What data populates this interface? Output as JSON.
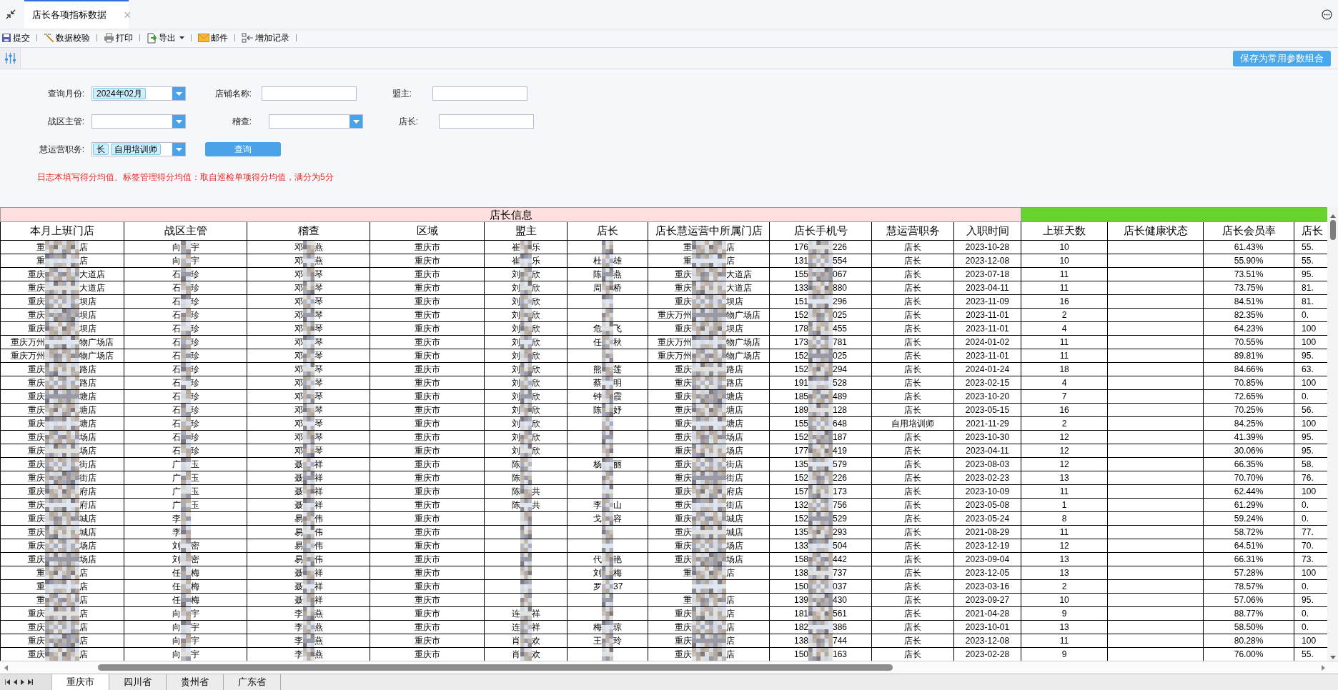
{
  "doc_tabs": [
    {
      "label": "店长各项指标数据",
      "selected": true,
      "close": "×"
    }
  ],
  "toolbar": [
    {
      "kind": "save",
      "label": "提交"
    },
    {
      "kind": "check",
      "label": "数据校验"
    },
    {
      "kind": "print",
      "label": "打印"
    },
    {
      "kind": "export",
      "label": "导出",
      "dropdown": true
    },
    {
      "kind": "mail",
      "label": "邮件"
    },
    {
      "kind": "add",
      "label": "增加记录"
    }
  ],
  "save_params_button": "保存为常用参数组合",
  "form": {
    "rows": [
      [
        {
          "label": "查询月份:",
          "kind": "combo",
          "tags": [
            "2024年02月"
          ]
        },
        {
          "label": "店铺名称:",
          "kind": "text"
        },
        {
          "label": "盟主:",
          "kind": "text"
        }
      ],
      [
        {
          "label": "战区主管:",
          "kind": "combo"
        },
        {
          "label": "稽查:",
          "kind": "combo"
        },
        {
          "label": "店长:",
          "kind": "text"
        }
      ],
      [
        {
          "label": "慧运营职务:",
          "kind": "combo",
          "tags": [
            "长",
            "自用培训师"
          ]
        },
        {
          "label": "查询",
          "kind": "button"
        }
      ]
    ],
    "note": "日志本填写得分均值、标签管理得分均值：取自巡检单项得分均值，满分为5分"
  },
  "table": {
    "groups": [
      {
        "label": "店长信息",
        "color": "#ffdfdf"
      },
      {
        "color": "#66d32e"
      }
    ],
    "columns": [
      {
        "header": "本月上班门店",
        "kind": "masked"
      },
      {
        "header": "战区主管",
        "kind": "masked"
      },
      {
        "header": "稽查",
        "kind": "masked"
      },
      {
        "header": "区域",
        "kind": "plain"
      },
      {
        "header": "盟主",
        "kind": "masked"
      },
      {
        "header": "店长",
        "kind": "masked"
      },
      {
        "header": "店长慧运营中所属门店",
        "kind": "masked"
      },
      {
        "header": "店长手机号",
        "kind": "masked"
      },
      {
        "header": "慧运营职务",
        "kind": "plain"
      },
      {
        "header": "入职时间",
        "kind": "plain"
      },
      {
        "header": "上班天数",
        "kind": "plain"
      },
      {
        "header": "店长健康状态",
        "kind": "plain"
      },
      {
        "header": "店长会员率",
        "kind": "plain"
      },
      {
        "header": "店长",
        "kind": "plain"
      }
    ],
    "rows": [
      [
        [
          "重",
          "店"
        ],
        [
          "向",
          "宇"
        ],
        [
          "邓",
          "燕"
        ],
        "重庆市",
        [
          "崔",
          "乐"
        ],
        null,
        [
          "重",
          "店"
        ],
        [
          "176",
          "226"
        ],
        "店长",
        "2023-10-28",
        "10",
        null,
        "61.43%",
        "55."
      ],
      [
        [
          "重",
          "店"
        ],
        [
          "向",
          "宇"
        ],
        [
          "邓",
          "燕"
        ],
        "重庆市",
        [
          "崔",
          "乐"
        ],
        [
          "杜",
          "雄"
        ],
        [
          "重",
          "店"
        ],
        [
          "131",
          "554"
        ],
        "店长",
        "2023-12-08",
        "10",
        null,
        "55.90%",
        "55."
      ],
      [
        [
          "重庆",
          "大道店"
        ],
        [
          "石",
          "珍"
        ],
        [
          "邓",
          "琴"
        ],
        "重庆市",
        [
          "刘",
          "欣"
        ],
        [
          "陈",
          "燕"
        ],
        [
          "重庆",
          "大道店"
        ],
        [
          "155",
          "067"
        ],
        "店长",
        "2023-07-18",
        "11",
        null,
        "73.51%",
        "95."
      ],
      [
        [
          "重庆",
          "大道店"
        ],
        [
          "石",
          "珍"
        ],
        [
          "邓",
          "琴"
        ],
        "重庆市",
        [
          "刘",
          "欣"
        ],
        [
          "周",
          "桥"
        ],
        [
          "重庆",
          "大道店"
        ],
        [
          "133",
          "880"
        ],
        "店长",
        "2023-04-11",
        "11",
        null,
        "73.75%",
        "81."
      ],
      [
        [
          "重庆",
          "坝店"
        ],
        [
          "石",
          "珍"
        ],
        [
          "邓",
          "琴"
        ],
        "重庆市",
        [
          "刘",
          "欣"
        ],
        null,
        [
          "重庆",
          "坝店"
        ],
        [
          "151",
          "296"
        ],
        "店长",
        "2023-11-09",
        "16",
        null,
        "84.51%",
        "81."
      ],
      [
        [
          "重庆",
          "坝店"
        ],
        [
          "石",
          "珍"
        ],
        [
          "邓",
          "琴"
        ],
        "重庆市",
        [
          "刘",
          "欣"
        ],
        null,
        [
          "重庆万州",
          "物广场店"
        ],
        [
          "152",
          "025"
        ],
        "店长",
        "2023-11-01",
        "2",
        null,
        "82.35%",
        "0."
      ],
      [
        [
          "重庆",
          "坝店"
        ],
        [
          "石",
          "珍"
        ],
        [
          "邓",
          "琴"
        ],
        "重庆市",
        [
          "刘",
          "欣"
        ],
        [
          "危",
          "飞"
        ],
        [
          "重庆",
          "坝店"
        ],
        [
          "178",
          "455"
        ],
        "店长",
        "2023-11-01",
        "4",
        null,
        "64.23%",
        "100"
      ],
      [
        [
          "重庆万州",
          "物广场店"
        ],
        [
          "石",
          "珍"
        ],
        [
          "邓",
          "琴"
        ],
        "重庆市",
        [
          "刘",
          "欣"
        ],
        [
          "任",
          "秋"
        ],
        [
          "重庆万州",
          "物广场店"
        ],
        [
          "173",
          "781"
        ],
        "店长",
        "2024-01-02",
        "11",
        null,
        "70.55%",
        "100"
      ],
      [
        [
          "重庆万州",
          "物广场店"
        ],
        [
          "石",
          "珍"
        ],
        [
          "邓",
          "琴"
        ],
        "重庆市",
        [
          "刘",
          "欣"
        ],
        null,
        [
          "重庆万州",
          "物广场店"
        ],
        [
          "152",
          "025"
        ],
        "店长",
        "2023-11-01",
        "11",
        null,
        "89.81%",
        "95."
      ],
      [
        [
          "重庆",
          "路店"
        ],
        [
          "石",
          "珍"
        ],
        [
          "邓",
          "琴"
        ],
        "重庆市",
        [
          "刘",
          "欣"
        ],
        [
          "熊",
          "莲"
        ],
        [
          "重庆",
          "路店"
        ],
        [
          "152",
          "294"
        ],
        "店长",
        "2024-01-24",
        "18",
        null,
        "84.66%",
        "63."
      ],
      [
        [
          "重庆",
          "路店"
        ],
        [
          "石",
          "珍"
        ],
        [
          "邓",
          "琴"
        ],
        "重庆市",
        [
          "刘",
          "欣"
        ],
        [
          "蔡",
          "明"
        ],
        [
          "重庆",
          "路店"
        ],
        [
          "191",
          "528"
        ],
        "店长",
        "2023-02-15",
        "4",
        null,
        "70.85%",
        "100"
      ],
      [
        [
          "重庆",
          "塘店"
        ],
        [
          "石",
          "珍"
        ],
        [
          "邓",
          "琴"
        ],
        "重庆市",
        [
          "刘",
          "欣"
        ],
        [
          "钟",
          "霞"
        ],
        [
          "重庆",
          "塘店"
        ],
        [
          "185",
          "489"
        ],
        "店长",
        "2023-10-20",
        "7",
        null,
        "72.65%",
        "0."
      ],
      [
        [
          "重庆",
          "塘店"
        ],
        [
          "石",
          "珍"
        ],
        [
          "邓",
          "琴"
        ],
        "重庆市",
        [
          "刘",
          "欣"
        ],
        [
          "陈",
          "妤"
        ],
        [
          "重庆",
          "塘店"
        ],
        [
          "189",
          "128"
        ],
        "店长",
        "2023-05-15",
        "16",
        null,
        "70.25%",
        "56."
      ],
      [
        [
          "重庆",
          "塘店"
        ],
        [
          "石",
          "珍"
        ],
        [
          "邓",
          "琴"
        ],
        "重庆市",
        [
          "刘",
          "欣"
        ],
        null,
        [
          "重庆",
          "塘店"
        ],
        [
          "155",
          "648"
        ],
        "自用培训师",
        "2021-11-29",
        "2",
        null,
        "84.25%",
        "100"
      ],
      [
        [
          "重庆",
          "场店"
        ],
        [
          "石",
          "珍"
        ],
        [
          "邓",
          "琴"
        ],
        "重庆市",
        [
          "刘",
          "欣"
        ],
        null,
        [
          "重庆",
          "场店"
        ],
        [
          "152",
          "187"
        ],
        "店长",
        "2023-10-30",
        "12",
        null,
        "41.39%",
        "95."
      ],
      [
        [
          "重庆",
          "场店"
        ],
        [
          "石",
          "珍"
        ],
        [
          "邓",
          "琴"
        ],
        "重庆市",
        [
          "刘",
          "欣"
        ],
        null,
        [
          "重庆",
          "场店"
        ],
        [
          "177",
          "419"
        ],
        "店长",
        "2023-04-11",
        "12",
        null,
        "30.06%",
        "95."
      ],
      [
        [
          "重庆",
          "街店"
        ],
        [
          "广",
          "玉"
        ],
        [
          "聂",
          "祥"
        ],
        "重庆市",
        [
          "陈",
          ""
        ],
        [
          "杨",
          "丽"
        ],
        [
          "重庆",
          "街店"
        ],
        [
          "135",
          "579"
        ],
        "店长",
        "2023-08-03",
        "12",
        null,
        "66.35%",
        "58."
      ],
      [
        [
          "重庆",
          "街店"
        ],
        [
          "广",
          "玉"
        ],
        [
          "聂",
          "祥"
        ],
        "重庆市",
        [
          "陈",
          ""
        ],
        null,
        [
          "重庆",
          "街店"
        ],
        [
          "152",
          "226"
        ],
        "店长",
        "2023-02-23",
        "13",
        null,
        "70.70%",
        "76."
      ],
      [
        [
          "重庆",
          "府店"
        ],
        [
          "广",
          "玉"
        ],
        [
          "聂",
          "祥"
        ],
        "重庆市",
        [
          "陈",
          "共"
        ],
        null,
        [
          "重庆",
          "府店"
        ],
        [
          "157",
          "173"
        ],
        "店长",
        "2023-10-09",
        "11",
        null,
        "62.44%",
        "100"
      ],
      [
        [
          "重庆",
          "府店"
        ],
        [
          "广",
          "玉"
        ],
        [
          "聂",
          "祥"
        ],
        "重庆市",
        [
          "陈",
          "共"
        ],
        [
          "李",
          "山"
        ],
        [
          "重庆",
          "街店"
        ],
        [
          "132",
          "756"
        ],
        "店长",
        "2023-05-08",
        "1",
        null,
        "61.29%",
        "0."
      ],
      [
        [
          "重庆",
          "城店"
        ],
        [
          "李",
          ""
        ],
        [
          "易",
          "伟"
        ],
        "重庆市",
        null,
        [
          "戈",
          "容"
        ],
        [
          "重庆",
          "城店"
        ],
        [
          "152",
          "529"
        ],
        "店长",
        "2023-05-24",
        "8",
        null,
        "59.24%",
        "0."
      ],
      [
        [
          "重庆",
          "城店"
        ],
        [
          "李",
          ""
        ],
        [
          "易",
          "伟"
        ],
        "重庆市",
        null,
        null,
        [
          "重庆",
          "城店"
        ],
        [
          "135",
          "293"
        ],
        "店长",
        "2021-08-29",
        "11",
        null,
        "58.72%",
        "77."
      ],
      [
        [
          "重庆",
          "场店"
        ],
        [
          "刘",
          "密"
        ],
        [
          "易",
          "伟"
        ],
        "重庆市",
        null,
        null,
        [
          "重庆",
          "场店"
        ],
        [
          "133",
          "504"
        ],
        "店长",
        "2023-12-19",
        "12",
        null,
        "64.51%",
        "70."
      ],
      [
        [
          "重庆",
          "场店"
        ],
        [
          "刘",
          "密"
        ],
        [
          "易",
          "伟"
        ],
        "重庆市",
        null,
        [
          "代",
          "艳"
        ],
        [
          "重庆",
          "场店"
        ],
        [
          "158",
          "442"
        ],
        "店长",
        "2023-09-04",
        "13",
        null,
        "66.31%",
        "73."
      ],
      [
        [
          "重",
          "店"
        ],
        [
          "任",
          "梅"
        ],
        [
          "聂",
          "祥"
        ],
        "重庆市",
        null,
        [
          "刘",
          "梅"
        ],
        [
          "重",
          "店"
        ],
        [
          "138",
          "737"
        ],
        "店长",
        "2023-12-05",
        "13",
        null,
        "57.28%",
        "100"
      ],
      [
        [
          "重",
          "店"
        ],
        [
          "任",
          "梅"
        ],
        [
          "聂",
          "祥"
        ],
        "重庆市",
        null,
        [
          "罗",
          "37"
        ],
        null,
        [
          "150",
          "037"
        ],
        "店长",
        "2023-03-16",
        "2",
        null,
        "78.57%",
        "0."
      ],
      [
        [
          "重",
          "店"
        ],
        [
          "任",
          "梅"
        ],
        [
          "聂",
          "祥"
        ],
        "重庆市",
        null,
        null,
        [
          "重",
          "店"
        ],
        [
          "139",
          "430"
        ],
        "店长",
        "2023-09-27",
        "10",
        null,
        "57.06%",
        "95."
      ],
      [
        [
          "重庆",
          "店"
        ],
        [
          "向",
          "宇"
        ],
        [
          "李",
          "燕"
        ],
        "重庆市",
        [
          "连",
          "祥"
        ],
        null,
        [
          "重庆",
          "店"
        ],
        [
          "181",
          "561"
        ],
        "店长",
        "2021-04-28",
        "9",
        null,
        "88.77%",
        "0."
      ],
      [
        [
          "重庆",
          "店"
        ],
        [
          "向",
          "宇"
        ],
        [
          "李",
          "燕"
        ],
        "重庆市",
        [
          "连",
          "祥"
        ],
        [
          "梅",
          "琼"
        ],
        [
          "重庆",
          "店"
        ],
        [
          "182",
          "386"
        ],
        "店长",
        "2023-10-01",
        "13",
        null,
        "58.50%",
        "0."
      ],
      [
        [
          "重庆",
          "店"
        ],
        [
          "向",
          "宇"
        ],
        [
          "李",
          "燕"
        ],
        "重庆市",
        [
          "肖",
          "欢"
        ],
        [
          "王",
          "玲"
        ],
        [
          "重庆",
          "店"
        ],
        [
          "138",
          "744"
        ],
        "店长",
        "2023-12-08",
        "11",
        null,
        "80.28%",
        "100"
      ],
      [
        [
          "重庆",
          "店"
        ],
        [
          "向",
          "宇"
        ],
        [
          "李",
          "燕"
        ],
        "重庆市",
        [
          "肖",
          "欢"
        ],
        null,
        [
          "重庆",
          "店"
        ],
        [
          "150",
          "163"
        ],
        "店长",
        "2023-02-28",
        "9",
        null,
        "76.00%",
        "55."
      ]
    ]
  },
  "sheet_tabs": [
    {
      "label": "重庆市",
      "selected": true
    },
    {
      "label": "四川省",
      "selected": false
    },
    {
      "label": "贵州省",
      "selected": false
    },
    {
      "label": "广东省",
      "selected": false
    }
  ]
}
